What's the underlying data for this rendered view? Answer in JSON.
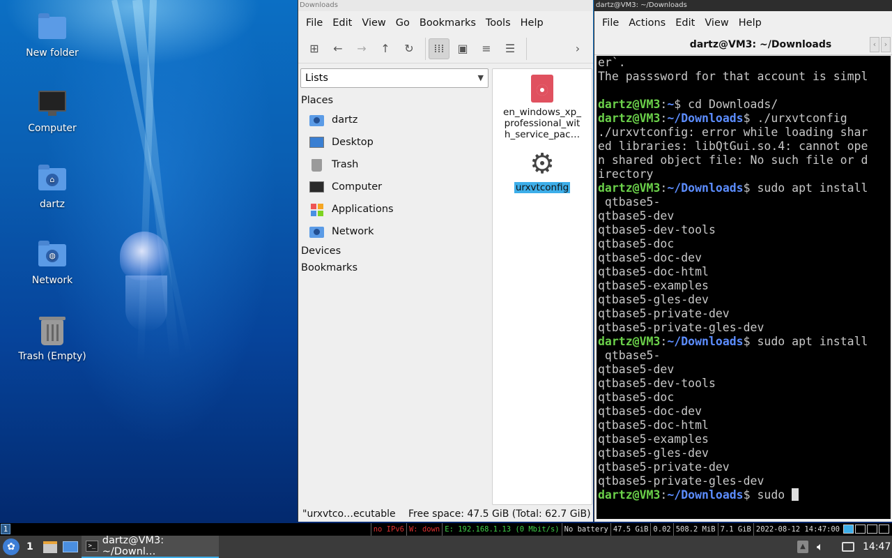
{
  "desktop": {
    "icons": [
      {
        "label": "New folder",
        "icon": "folder-icon"
      },
      {
        "label": "Computer",
        "icon": "computer-icon"
      },
      {
        "label": "dartz",
        "icon": "home-folder-icon"
      },
      {
        "label": "Network",
        "icon": "network-folder-icon"
      },
      {
        "label": "Trash (Empty)",
        "icon": "trash-icon"
      }
    ]
  },
  "file_manager": {
    "title": "Downloads",
    "menu": [
      "File",
      "Edit",
      "View",
      "Go",
      "Bookmarks",
      "Tools",
      "Help"
    ],
    "side_pane_mode": "Lists",
    "places_header": "Places",
    "places": [
      "dartz",
      "Desktop",
      "Trash",
      "Computer",
      "Applications",
      "Network"
    ],
    "devices_header": "Devices",
    "bookmarks_header": "Bookmarks",
    "files": [
      {
        "name": "en_windows_xp_ professional_wit h_service_pac…",
        "lines": [
          "en_windows_xp_",
          "professional_wit",
          "h_service_pac…"
        ],
        "icon": "disc-image-icon",
        "selected": false
      },
      {
        "name": "urxvtconfig",
        "icon": "gear-icon",
        "selected": true
      }
    ],
    "status_left": "\"urxvtco…ecutable",
    "status_right": "Free space: 47.5 GiB (Total: 62.7 GiB)"
  },
  "terminal": {
    "window_title": "dartz@VM3: ~/Downloads",
    "menu": [
      "File",
      "Actions",
      "Edit",
      "View",
      "Help"
    ],
    "tab_title": "dartz@VM3: ~/Downloads",
    "prompt_user": "dartz@VM3",
    "lines": [
      {
        "type": "out",
        "text": "er`."
      },
      {
        "type": "out",
        "text": "The passsword for that account is simpl"
      },
      {
        "type": "out",
        "text": ""
      },
      {
        "type": "prompt",
        "path": "~",
        "cmd": "cd Downloads/"
      },
      {
        "type": "prompt",
        "path": "~/Downloads",
        "cmd": "./urxvtconfig"
      },
      {
        "type": "out",
        "text": "./urxvtconfig: error while loading shar"
      },
      {
        "type": "out",
        "text": "ed libraries: libQtGui.so.4: cannot ope"
      },
      {
        "type": "out",
        "text": "n shared object file: No such file or d"
      },
      {
        "type": "out",
        "text": "irectory"
      },
      {
        "type": "prompt",
        "path": "~/Downloads",
        "cmd": "sudo apt install"
      },
      {
        "type": "out",
        "text": " qtbase5-"
      },
      {
        "type": "out",
        "text": "qtbase5-dev"
      },
      {
        "type": "out",
        "text": "qtbase5-dev-tools"
      },
      {
        "type": "out",
        "text": "qtbase5-doc"
      },
      {
        "type": "out",
        "text": "qtbase5-doc-dev"
      },
      {
        "type": "out",
        "text": "qtbase5-doc-html"
      },
      {
        "type": "out",
        "text": "qtbase5-examples"
      },
      {
        "type": "out",
        "text": "qtbase5-gles-dev"
      },
      {
        "type": "out",
        "text": "qtbase5-private-dev"
      },
      {
        "type": "out",
        "text": "qtbase5-private-gles-dev"
      },
      {
        "type": "prompt",
        "path": "~/Downloads",
        "cmd": "sudo apt install"
      },
      {
        "type": "out",
        "text": " qtbase5-"
      },
      {
        "type": "out",
        "text": "qtbase5-dev"
      },
      {
        "type": "out",
        "text": "qtbase5-dev-tools"
      },
      {
        "type": "out",
        "text": "qtbase5-doc"
      },
      {
        "type": "out",
        "text": "qtbase5-doc-dev"
      },
      {
        "type": "out",
        "text": "qtbase5-doc-html"
      },
      {
        "type": "out",
        "text": "qtbase5-examples"
      },
      {
        "type": "out",
        "text": "qtbase5-gles-dev"
      },
      {
        "type": "out",
        "text": "qtbase5-private-dev"
      },
      {
        "type": "out",
        "text": "qtbase5-private-gles-dev"
      },
      {
        "type": "prompt",
        "path": "~/Downloads",
        "cmd": "sudo ",
        "cursor": true
      }
    ]
  },
  "statusline": {
    "workspace": "1",
    "items": [
      {
        "text": "no IPv6",
        "color": "#e03030"
      },
      {
        "text": "W: down",
        "color": "#e03030"
      },
      {
        "text": "E: 192.168.1.13 (0 Mbit/s)",
        "color": "#3fd24a"
      },
      {
        "text": "No battery",
        "color": "#dddddd"
      },
      {
        "text": "47.5 GiB",
        "color": "#dddddd"
      },
      {
        "text": "0.02",
        "color": "#dddddd"
      },
      {
        "text": "508.2 MiB",
        "color": "#dddddd"
      },
      {
        "text": "7.1 GiB",
        "color": "#dddddd"
      },
      {
        "text": "2022-08-12 14:47:00",
        "color": "#dddddd"
      }
    ]
  },
  "taskbar": {
    "workspace": "1",
    "task_label": "dartz@VM3: ~/Downl…",
    "clock": "14:47"
  },
  "colors": {
    "accent": "#3daee9",
    "prompt_user": "#6bd14a",
    "prompt_path": "#5c8dff"
  }
}
